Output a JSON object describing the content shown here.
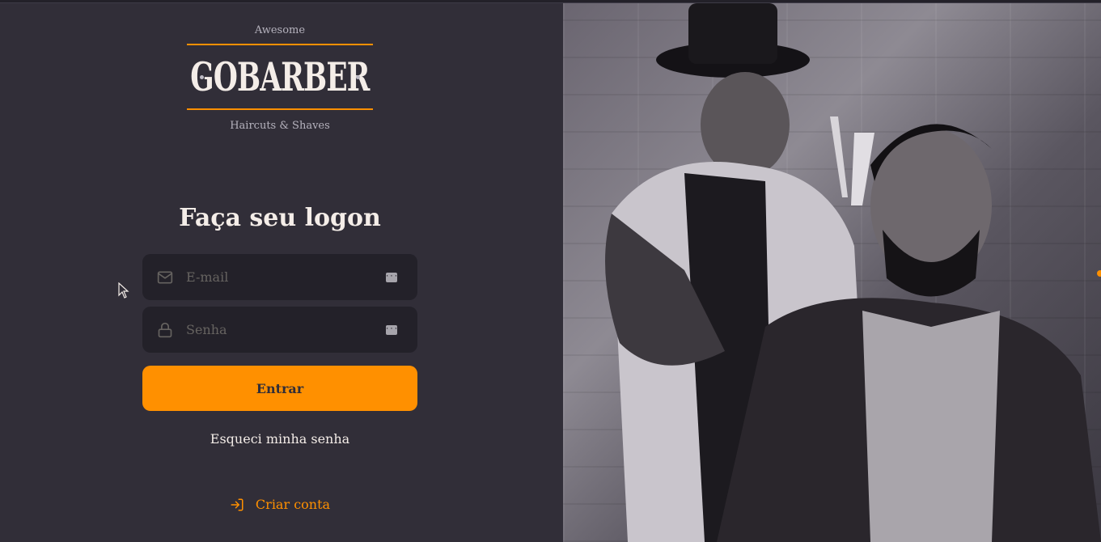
{
  "logo": {
    "awesome": "Awesome",
    "brand": "GOBARBER",
    "tagline": "Haircuts & Shaves"
  },
  "form": {
    "title": "Faça seu logon",
    "email_placeholder": "E-mail",
    "password_placeholder": "Senha",
    "submit_label": "Entrar",
    "forgot_label": "Esqueci minha senha"
  },
  "create_account": {
    "label": "Criar conta"
  },
  "icons": {
    "email": "mail-icon",
    "password": "lock-icon",
    "autofill": "key-icon",
    "create": "log-in-icon"
  },
  "colors": {
    "background": "#312e38",
    "input_bg": "#232129",
    "accent": "#ff9000",
    "text": "#f4ede8",
    "placeholder": "#666360"
  }
}
